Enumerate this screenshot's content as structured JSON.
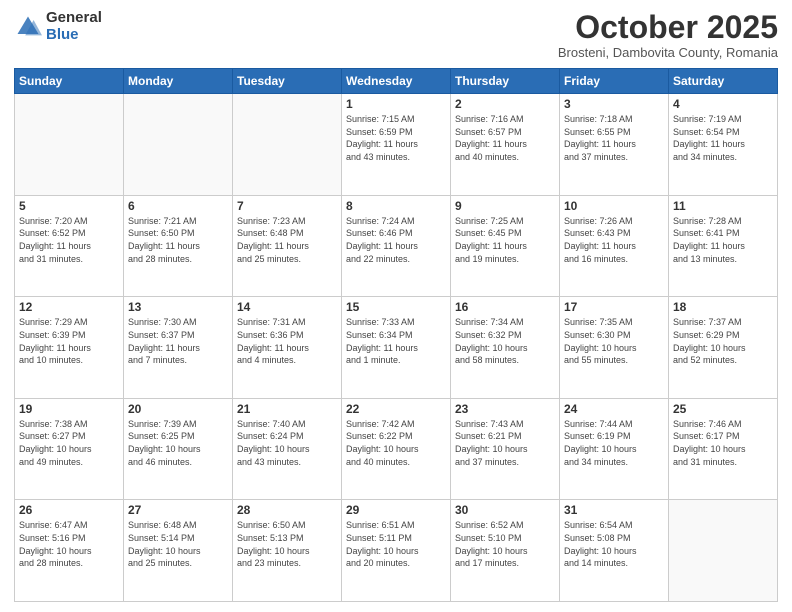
{
  "logo": {
    "general": "General",
    "blue": "Blue"
  },
  "header": {
    "month": "October 2025",
    "location": "Brosteni, Dambovita County, Romania"
  },
  "weekdays": [
    "Sunday",
    "Monday",
    "Tuesday",
    "Wednesday",
    "Thursday",
    "Friday",
    "Saturday"
  ],
  "weeks": [
    [
      {
        "day": "",
        "info": ""
      },
      {
        "day": "",
        "info": ""
      },
      {
        "day": "",
        "info": ""
      },
      {
        "day": "1",
        "info": "Sunrise: 7:15 AM\nSunset: 6:59 PM\nDaylight: 11 hours\nand 43 minutes."
      },
      {
        "day": "2",
        "info": "Sunrise: 7:16 AM\nSunset: 6:57 PM\nDaylight: 11 hours\nand 40 minutes."
      },
      {
        "day": "3",
        "info": "Sunrise: 7:18 AM\nSunset: 6:55 PM\nDaylight: 11 hours\nand 37 minutes."
      },
      {
        "day": "4",
        "info": "Sunrise: 7:19 AM\nSunset: 6:54 PM\nDaylight: 11 hours\nand 34 minutes."
      }
    ],
    [
      {
        "day": "5",
        "info": "Sunrise: 7:20 AM\nSunset: 6:52 PM\nDaylight: 11 hours\nand 31 minutes."
      },
      {
        "day": "6",
        "info": "Sunrise: 7:21 AM\nSunset: 6:50 PM\nDaylight: 11 hours\nand 28 minutes."
      },
      {
        "day": "7",
        "info": "Sunrise: 7:23 AM\nSunset: 6:48 PM\nDaylight: 11 hours\nand 25 minutes."
      },
      {
        "day": "8",
        "info": "Sunrise: 7:24 AM\nSunset: 6:46 PM\nDaylight: 11 hours\nand 22 minutes."
      },
      {
        "day": "9",
        "info": "Sunrise: 7:25 AM\nSunset: 6:45 PM\nDaylight: 11 hours\nand 19 minutes."
      },
      {
        "day": "10",
        "info": "Sunrise: 7:26 AM\nSunset: 6:43 PM\nDaylight: 11 hours\nand 16 minutes."
      },
      {
        "day": "11",
        "info": "Sunrise: 7:28 AM\nSunset: 6:41 PM\nDaylight: 11 hours\nand 13 minutes."
      }
    ],
    [
      {
        "day": "12",
        "info": "Sunrise: 7:29 AM\nSunset: 6:39 PM\nDaylight: 11 hours\nand 10 minutes."
      },
      {
        "day": "13",
        "info": "Sunrise: 7:30 AM\nSunset: 6:37 PM\nDaylight: 11 hours\nand 7 minutes."
      },
      {
        "day": "14",
        "info": "Sunrise: 7:31 AM\nSunset: 6:36 PM\nDaylight: 11 hours\nand 4 minutes."
      },
      {
        "day": "15",
        "info": "Sunrise: 7:33 AM\nSunset: 6:34 PM\nDaylight: 11 hours\nand 1 minute."
      },
      {
        "day": "16",
        "info": "Sunrise: 7:34 AM\nSunset: 6:32 PM\nDaylight: 10 hours\nand 58 minutes."
      },
      {
        "day": "17",
        "info": "Sunrise: 7:35 AM\nSunset: 6:30 PM\nDaylight: 10 hours\nand 55 minutes."
      },
      {
        "day": "18",
        "info": "Sunrise: 7:37 AM\nSunset: 6:29 PM\nDaylight: 10 hours\nand 52 minutes."
      }
    ],
    [
      {
        "day": "19",
        "info": "Sunrise: 7:38 AM\nSunset: 6:27 PM\nDaylight: 10 hours\nand 49 minutes."
      },
      {
        "day": "20",
        "info": "Sunrise: 7:39 AM\nSunset: 6:25 PM\nDaylight: 10 hours\nand 46 minutes."
      },
      {
        "day": "21",
        "info": "Sunrise: 7:40 AM\nSunset: 6:24 PM\nDaylight: 10 hours\nand 43 minutes."
      },
      {
        "day": "22",
        "info": "Sunrise: 7:42 AM\nSunset: 6:22 PM\nDaylight: 10 hours\nand 40 minutes."
      },
      {
        "day": "23",
        "info": "Sunrise: 7:43 AM\nSunset: 6:21 PM\nDaylight: 10 hours\nand 37 minutes."
      },
      {
        "day": "24",
        "info": "Sunrise: 7:44 AM\nSunset: 6:19 PM\nDaylight: 10 hours\nand 34 minutes."
      },
      {
        "day": "25",
        "info": "Sunrise: 7:46 AM\nSunset: 6:17 PM\nDaylight: 10 hours\nand 31 minutes."
      }
    ],
    [
      {
        "day": "26",
        "info": "Sunrise: 6:47 AM\nSunset: 5:16 PM\nDaylight: 10 hours\nand 28 minutes."
      },
      {
        "day": "27",
        "info": "Sunrise: 6:48 AM\nSunset: 5:14 PM\nDaylight: 10 hours\nand 25 minutes."
      },
      {
        "day": "28",
        "info": "Sunrise: 6:50 AM\nSunset: 5:13 PM\nDaylight: 10 hours\nand 23 minutes."
      },
      {
        "day": "29",
        "info": "Sunrise: 6:51 AM\nSunset: 5:11 PM\nDaylight: 10 hours\nand 20 minutes."
      },
      {
        "day": "30",
        "info": "Sunrise: 6:52 AM\nSunset: 5:10 PM\nDaylight: 10 hours\nand 17 minutes."
      },
      {
        "day": "31",
        "info": "Sunrise: 6:54 AM\nSunset: 5:08 PM\nDaylight: 10 hours\nand 14 minutes."
      },
      {
        "day": "",
        "info": ""
      }
    ]
  ]
}
